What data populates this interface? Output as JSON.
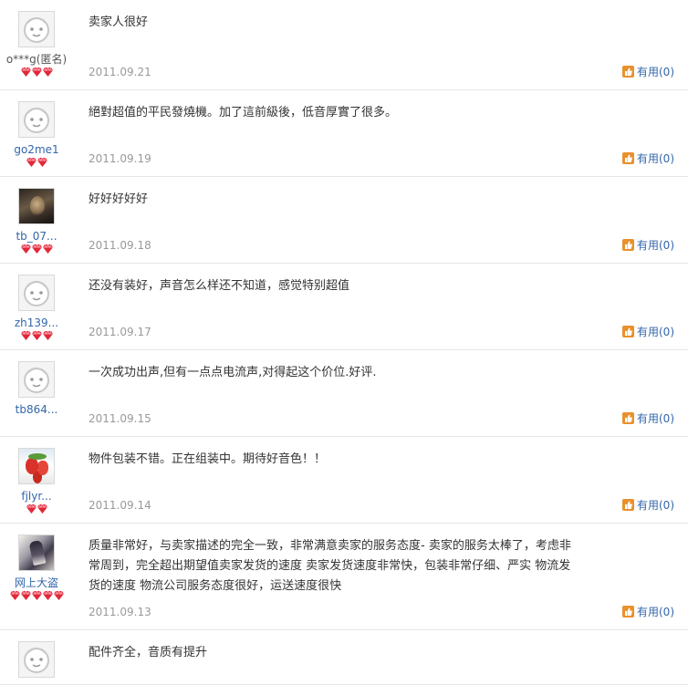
{
  "reviews": [
    {
      "user": "o***g(匿名)",
      "user_link": false,
      "avatar": "default",
      "gems": 3,
      "text": "卖家人很好",
      "date": "2011.09.21",
      "useful": "有用(0)"
    },
    {
      "user": "go2me1",
      "user_link": true,
      "avatar": "default",
      "gems": 2,
      "text": "絕對超值的平民發燒機。加了這前級後，低音厚實了很多。",
      "date": "2011.09.19",
      "useful": "有用(0)"
    },
    {
      "user": "tb_07...",
      "user_link": true,
      "avatar": "photo-dark",
      "gems": 3,
      "text": "好好好好好",
      "date": "2011.09.18",
      "useful": "有用(0)"
    },
    {
      "user": "zh139...",
      "user_link": true,
      "avatar": "default",
      "gems": 3,
      "text": "还没有装好，声音怎么样还不知道，感觉特别超值",
      "date": "2011.09.17",
      "useful": "有用(0)"
    },
    {
      "user": "tb864...",
      "user_link": true,
      "avatar": "default",
      "gems": 0,
      "text": "一次成功出声,但有一点点电流声,对得起这个价位.好评.",
      "date": "2011.09.15",
      "useful": "有用(0)"
    },
    {
      "user": "fjlyr...",
      "user_link": true,
      "avatar": "photo-fruit",
      "gems": 2,
      "text": "物件包装不错。正在组装中。期待好音色！！",
      "date": "2011.09.14",
      "useful": "有用(0)"
    },
    {
      "user": "网上大盗",
      "user_link": true,
      "avatar": "photo-warrior",
      "gems": 5,
      "text_lines": [
        "质量非常好，与卖家描述的完全一致，非常满意卖家的服务态度- 卖家的服务太棒了，考虑非",
        "常周到，完全超出期望值卖家发货的速度 卖家发货速度非常快，包装非常仔细、严实 物流发",
        "货的速度 物流公司服务态度很好，运送速度很快"
      ],
      "date": "2011.09.13",
      "useful": "有用(0)"
    },
    {
      "user": "",
      "user_link": false,
      "avatar": "default",
      "gems": 0,
      "text": "配件齐全，音质有提升",
      "date": "",
      "useful": ""
    }
  ],
  "colors": {
    "gem": "#e0283a",
    "link": "#3366aa",
    "date": "#999999",
    "divider": "#e6e6e6",
    "thumb": "#e8912d"
  },
  "icons": {
    "rating": "diamond-icon",
    "useful": "thumbs-up-icon",
    "default_avatar": "default-face-avatar"
  }
}
